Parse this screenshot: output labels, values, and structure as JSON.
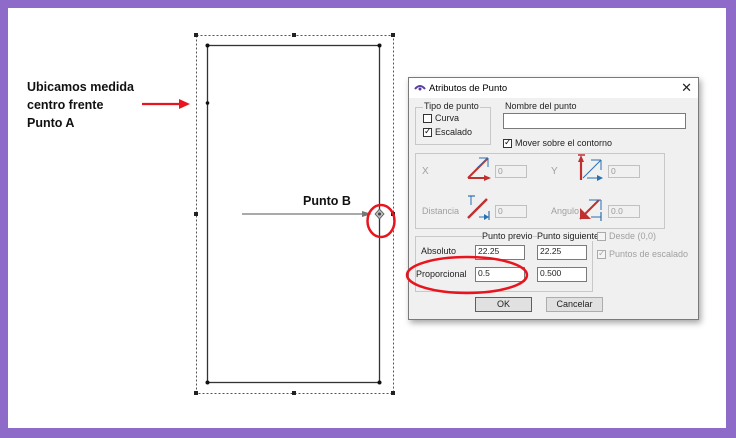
{
  "annotations": {
    "left_label": [
      "Ubicamos medida",
      "centro frente",
      "Punto A"
    ],
    "point_b_label": "Punto B"
  },
  "dialog": {
    "title": "Atributos de Punto",
    "close_symbol": "✕",
    "tipo_de_punto": {
      "label": "Tipo de punto",
      "curva": {
        "label": "Curva",
        "checked": false
      },
      "escalado": {
        "label": "Escalado",
        "checked": true
      }
    },
    "nombre_del_punto": {
      "label": "Nombre del punto",
      "value": ""
    },
    "mover_sobre_contorno": {
      "label": "Mover sobre el contorno",
      "checked": true
    },
    "coords": {
      "x": {
        "label": "X",
        "value": "0"
      },
      "y": {
        "label": "Y",
        "value": "0"
      },
      "distancia": {
        "label": "Distancia",
        "value": "0"
      },
      "angulo": {
        "label": "Angulo",
        "value": "0.0"
      }
    },
    "punto_previo_header": "Punto previo",
    "punto_siguiente_header": "Punto siguiente",
    "absoluto": {
      "label": "Absoluto",
      "previo": "22.25",
      "siguiente": "22.25"
    },
    "proporcional": {
      "label": "Proporcional",
      "previo": "0.5",
      "siguiente": "0.500"
    },
    "desde": {
      "label": "Desde (0,0)",
      "checked": false
    },
    "puntos_de_escalado": {
      "label": "Puntos de escalado",
      "checked": true
    },
    "ok_label": "OK",
    "cancel_label": "Cancelar"
  },
  "colors": {
    "accent_red": "#e8141e",
    "frame_purple": "#8e6bc9",
    "ok_border": "#0078d7"
  }
}
